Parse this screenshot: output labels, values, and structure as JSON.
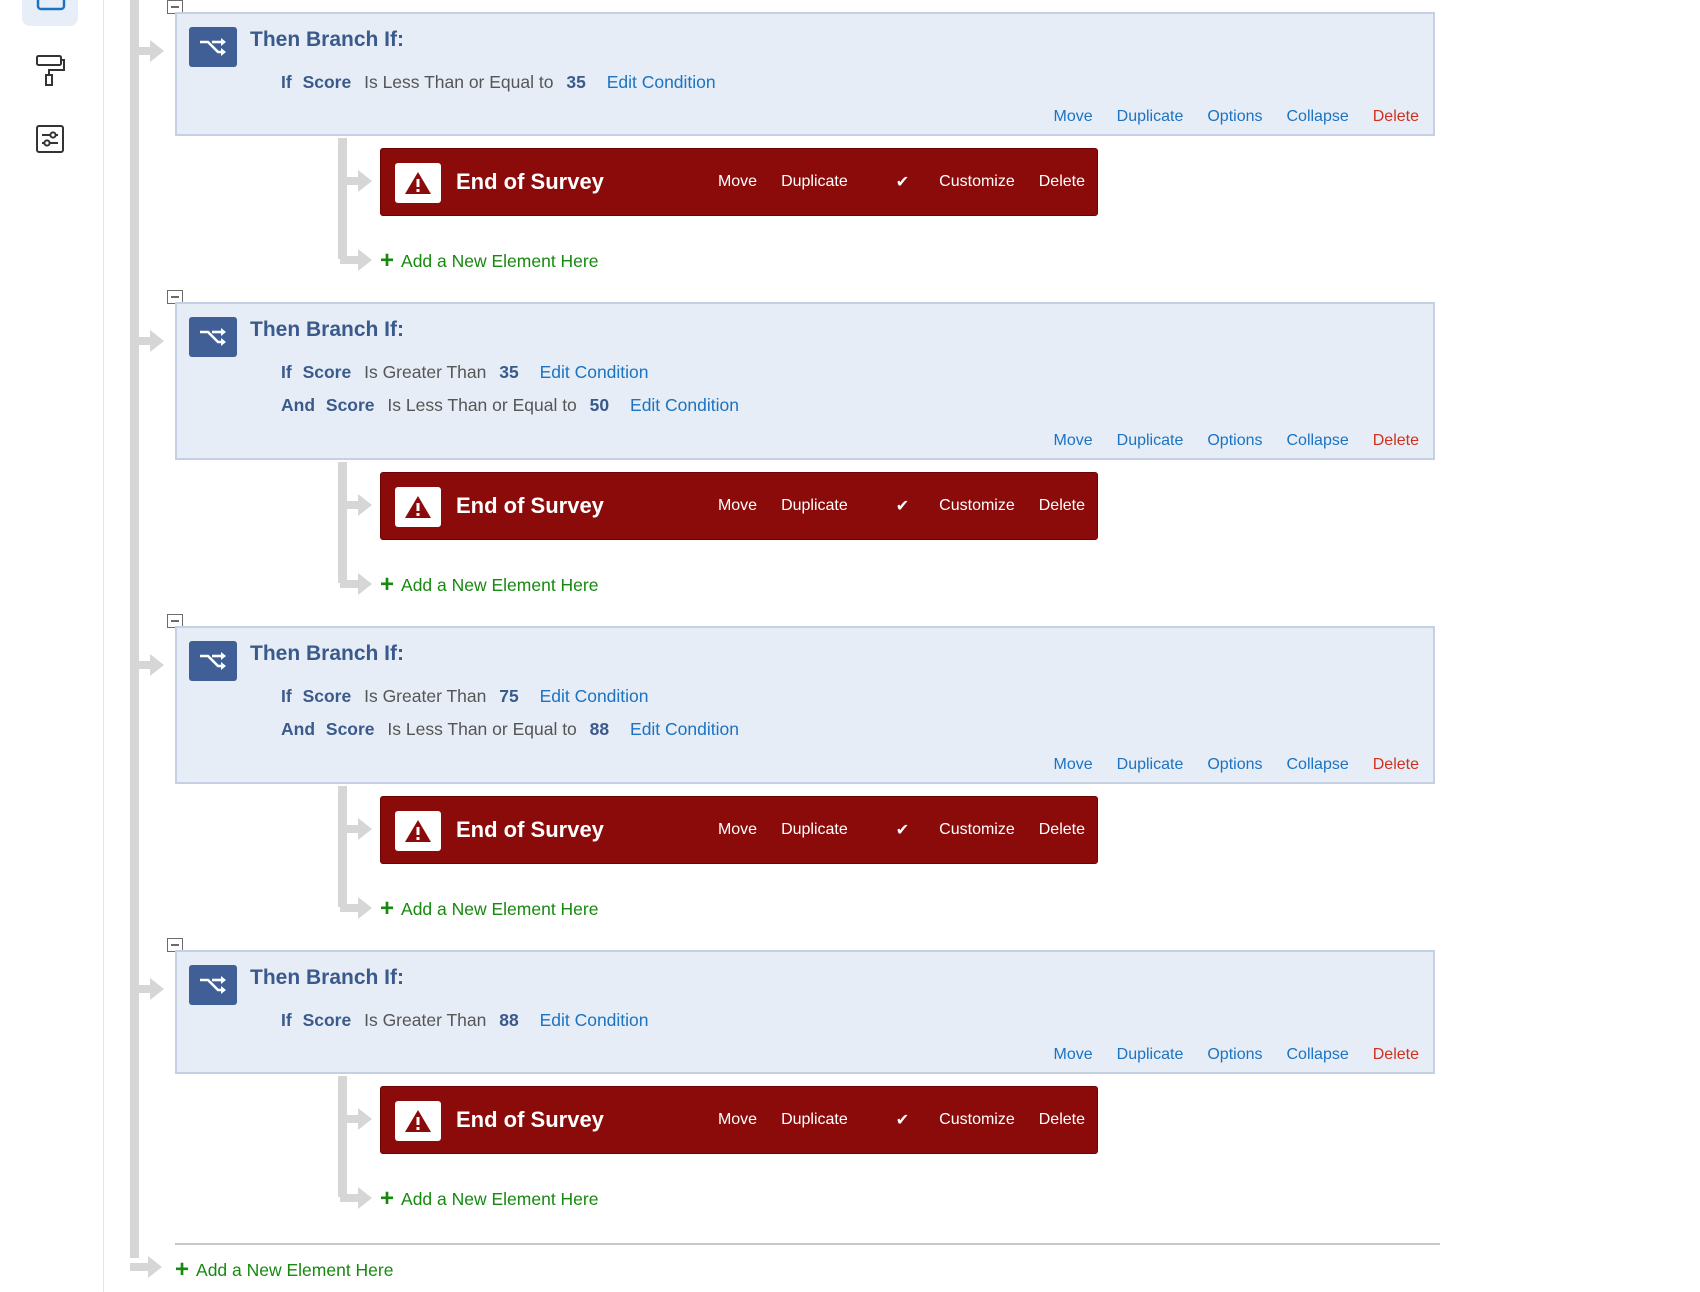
{
  "rail": {
    "items": [
      {
        "icon": "survey-flow-icon",
        "active": true
      },
      {
        "icon": "paint-roller-icon",
        "active": false
      },
      {
        "icon": "survey-options-icon",
        "active": false
      }
    ]
  },
  "branches": [
    {
      "title": "Then Branch If:",
      "conditions": [
        {
          "conj": "If",
          "field": "Score",
          "op": "Is Less Than or Equal to",
          "value": "35",
          "edit": "Edit Condition"
        }
      ],
      "actions": {
        "move": "Move",
        "duplicate": "Duplicate",
        "options": "Options",
        "collapse": "Collapse",
        "delete": "Delete"
      },
      "end": {
        "title": "End of Survey",
        "move": "Move",
        "duplicate": "Duplicate",
        "customize": "Customize",
        "delete": "Delete"
      },
      "add_label": "Add a New Element Here"
    },
    {
      "title": "Then Branch If:",
      "conditions": [
        {
          "conj": "If",
          "field": "Score",
          "op": "Is Greater Than",
          "value": "35",
          "edit": "Edit Condition"
        },
        {
          "conj": "And",
          "field": "Score",
          "op": "Is Less Than or Equal to",
          "value": "50",
          "edit": "Edit Condition"
        }
      ],
      "actions": {
        "move": "Move",
        "duplicate": "Duplicate",
        "options": "Options",
        "collapse": "Collapse",
        "delete": "Delete"
      },
      "end": {
        "title": "End of Survey",
        "move": "Move",
        "duplicate": "Duplicate",
        "customize": "Customize",
        "delete": "Delete"
      },
      "add_label": "Add a New Element Here"
    },
    {
      "title": "Then Branch If:",
      "conditions": [
        {
          "conj": "If",
          "field": "Score",
          "op": "Is Greater Than",
          "value": "75",
          "edit": "Edit Condition"
        },
        {
          "conj": "And",
          "field": "Score",
          "op": "Is Less Than or Equal to",
          "value": "88",
          "edit": "Edit Condition"
        }
      ],
      "actions": {
        "move": "Move",
        "duplicate": "Duplicate",
        "options": "Options",
        "collapse": "Collapse",
        "delete": "Delete"
      },
      "end": {
        "title": "End of Survey",
        "move": "Move",
        "duplicate": "Duplicate",
        "customize": "Customize",
        "delete": "Delete"
      },
      "add_label": "Add a New Element Here"
    },
    {
      "title": "Then Branch If:",
      "conditions": [
        {
          "conj": "If",
          "field": "Score",
          "op": "Is Greater Than",
          "value": "88",
          "edit": "Edit Condition"
        }
      ],
      "actions": {
        "move": "Move",
        "duplicate": "Duplicate",
        "options": "Options",
        "collapse": "Collapse",
        "delete": "Delete"
      },
      "end": {
        "title": "End of Survey",
        "move": "Move",
        "duplicate": "Duplicate",
        "customize": "Customize",
        "delete": "Delete"
      },
      "add_label": "Add a New Element Here"
    }
  ],
  "bottom_add_label": "Add a New Element Here",
  "colors": {
    "branch_bg": "#e7edf6",
    "branch_accent": "#3f5f96",
    "end_of_survey": "#8b0b0b",
    "link": "#1b73c2",
    "delete": "#d0301e",
    "add": "#17890f"
  }
}
